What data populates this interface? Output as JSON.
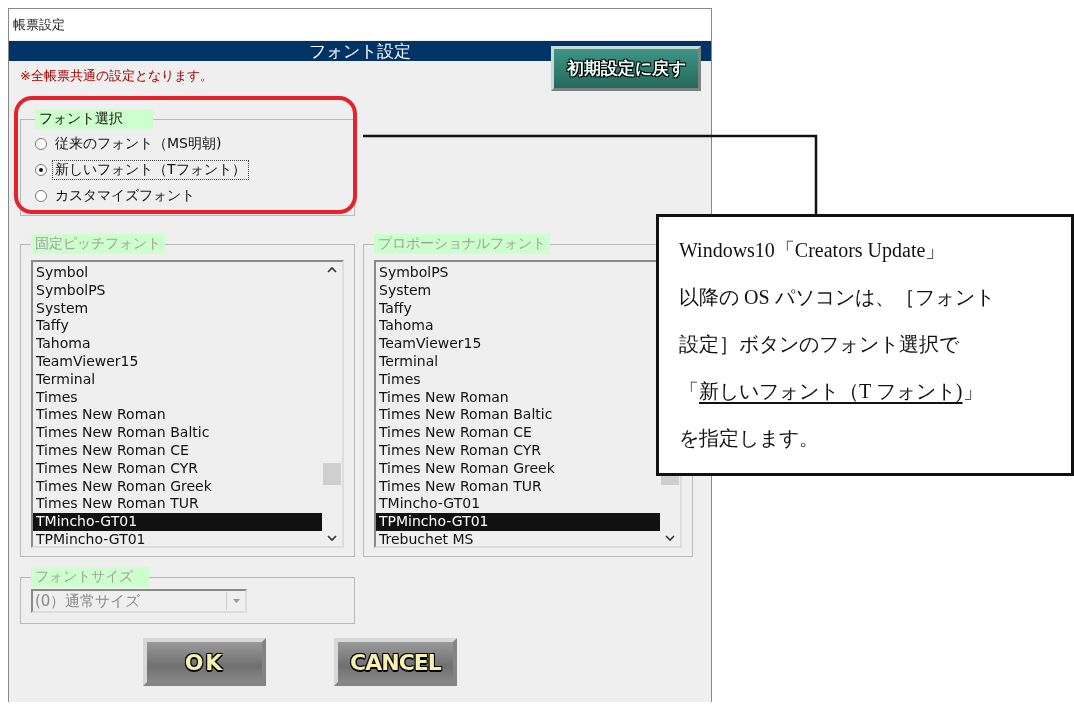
{
  "window": {
    "title": "帳票設定"
  },
  "header": {
    "title": "フォント設定",
    "reset_button": "初期設定に戻す"
  },
  "notice": "※全帳票共通の設定となります。",
  "font_choice": {
    "legend": "フォント選択",
    "disabled": false,
    "highlighted": true,
    "options": [
      {
        "label": "従来のフォント（MS明朝)",
        "selected": false
      },
      {
        "label": "新しいフォント（Tフォント）",
        "selected": true
      },
      {
        "label": "カスタマイズフォント",
        "selected": false
      }
    ]
  },
  "font_lists": [
    {
      "legend": "固定ピッチフォント",
      "disabled": true,
      "items": [
        {
          "label": "Symbol",
          "selected": false
        },
        {
          "label": "SymbolPS",
          "selected": false
        },
        {
          "label": "System",
          "selected": false
        },
        {
          "label": "Taffy",
          "selected": false
        },
        {
          "label": "Tahoma",
          "selected": false
        },
        {
          "label": "TeamViewer15",
          "selected": false
        },
        {
          "label": "Terminal",
          "selected": false
        },
        {
          "label": "Times",
          "selected": false
        },
        {
          "label": "Times New Roman",
          "selected": false
        },
        {
          "label": "Times New Roman Baltic",
          "selected": false
        },
        {
          "label": "Times New Roman CE",
          "selected": false
        },
        {
          "label": "Times New Roman CYR",
          "selected": false
        },
        {
          "label": "Times New Roman Greek",
          "selected": false
        },
        {
          "label": "Times New Roman TUR",
          "selected": false
        },
        {
          "label": "TMincho-GT01",
          "selected": true
        },
        {
          "label": "TPMincho-GT01",
          "selected": false
        }
      ]
    },
    {
      "legend": "プロポーショナルフォント",
      "disabled": true,
      "items": [
        {
          "label": "SymbolPS",
          "selected": false
        },
        {
          "label": "System",
          "selected": false
        },
        {
          "label": "Taffy",
          "selected": false
        },
        {
          "label": "Tahoma",
          "selected": false
        },
        {
          "label": "TeamViewer15",
          "selected": false
        },
        {
          "label": "Terminal",
          "selected": false
        },
        {
          "label": "Times",
          "selected": false
        },
        {
          "label": "Times New Roman",
          "selected": false
        },
        {
          "label": "Times New Roman Baltic",
          "selected": false
        },
        {
          "label": "Times New Roman CE",
          "selected": false
        },
        {
          "label": "Times New Roman CYR",
          "selected": false
        },
        {
          "label": "Times New Roman Greek",
          "selected": false
        },
        {
          "label": "Times New Roman TUR",
          "selected": false
        },
        {
          "label": "TMincho-GT01",
          "selected": false
        },
        {
          "label": "TPMincho-GT01",
          "selected": true
        },
        {
          "label": "Trebuchet MS",
          "selected": false
        }
      ]
    }
  ],
  "font_size": {
    "legend": "フォントサイズ",
    "disabled": true,
    "value": "(0）通常サイズ"
  },
  "buttons": [
    {
      "label": "OK"
    },
    {
      "label": "CANCEL"
    }
  ],
  "callout": {
    "lines": [
      {
        "text": "Windows10「Creators Update」"
      },
      {
        "text": "以降の OS パソコンは、［フォント"
      },
      {
        "text": "設定］ボタンのフォント選択で"
      },
      {
        "text": "「",
        "underlined": "新しいフォント（T フォント)",
        "after": "」"
      },
      {
        "text": "を指定します。"
      }
    ]
  }
}
